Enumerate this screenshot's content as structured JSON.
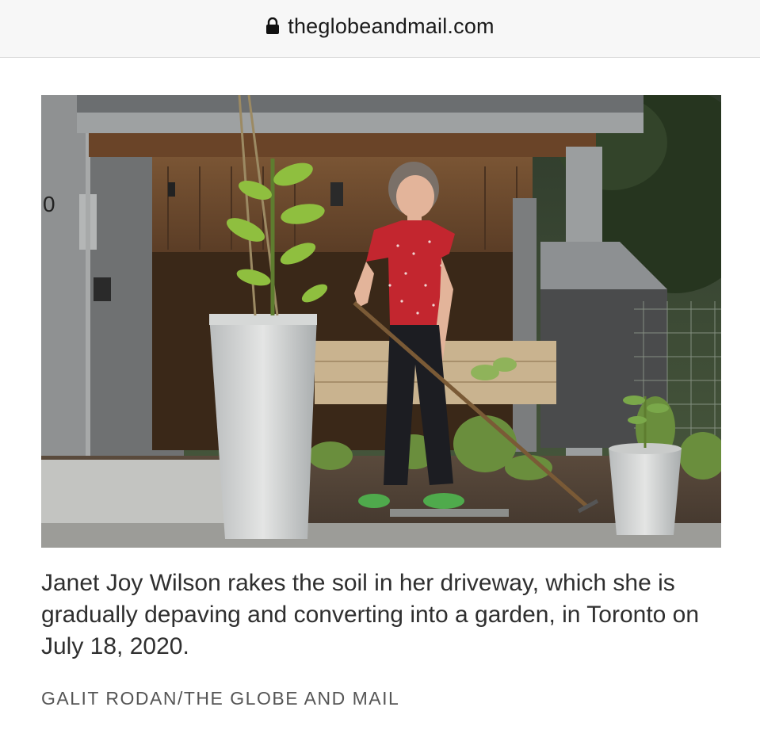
{
  "browser": {
    "url": "theglobeandmail.com",
    "lock_icon": "lock-icon"
  },
  "article": {
    "photo": {
      "house_number": "0"
    },
    "caption": "Janet Joy Wilson rakes the soil in her driveway, which she is gradually depaving and converting into a garden, in Toronto on July 18, 2020.",
    "credit": "GALIT RODAN/THE GLOBE AND MAIL"
  }
}
